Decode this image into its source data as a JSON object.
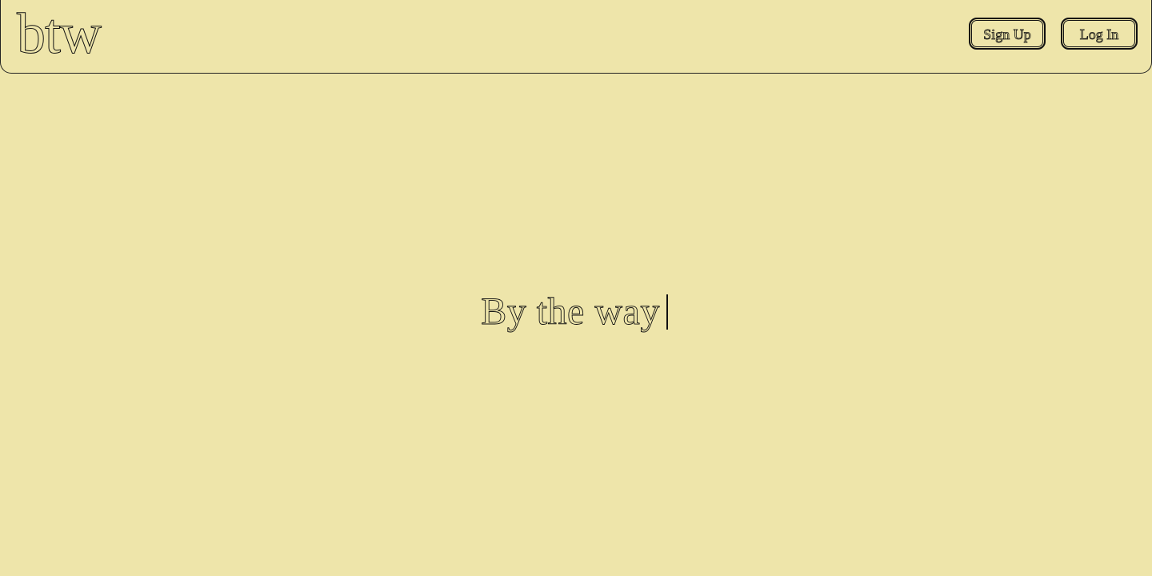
{
  "app": {
    "logo_text": "btw"
  },
  "header": {
    "signup_label": "Sign Up",
    "login_label": "Log In"
  },
  "hero": {
    "typed_text": "By the way"
  },
  "colors": {
    "background": "#EEE5AA",
    "ink": "#111111"
  }
}
